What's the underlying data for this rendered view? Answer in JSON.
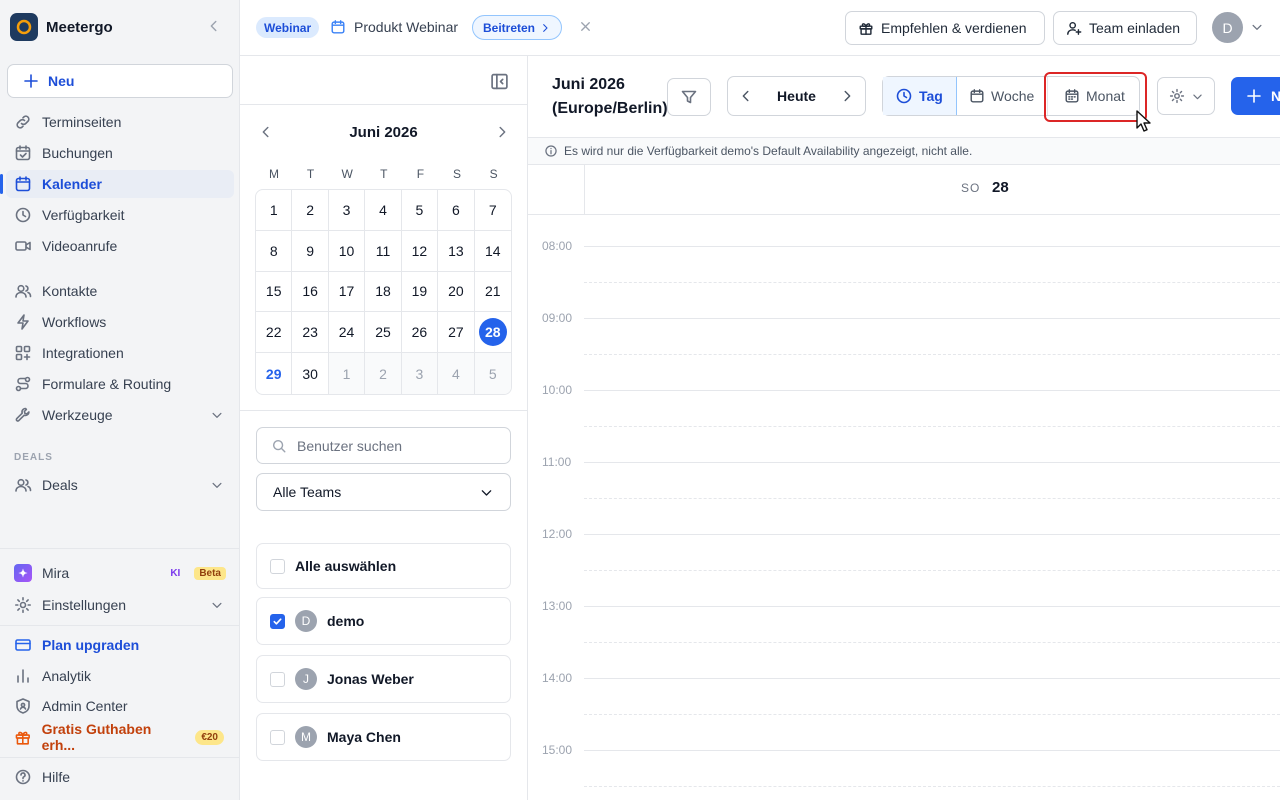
{
  "sidebar": {
    "brand": "Meetergo",
    "new_label": "Neu",
    "nav": [
      {
        "label": "Terminseiten",
        "icon": "link-icon"
      },
      {
        "label": "Buchungen",
        "icon": "calendar-check-icon"
      },
      {
        "label": "Kalender",
        "icon": "calendar-icon",
        "active": true
      },
      {
        "label": "Verfügbarkeit",
        "icon": "clock-icon"
      },
      {
        "label": "Videoanrufe",
        "icon": "video-icon"
      },
      {
        "label": "Kontakte",
        "icon": "users-icon"
      },
      {
        "label": "Workflows",
        "icon": "bolt-icon"
      },
      {
        "label": "Integrationen",
        "icon": "grid-icon"
      },
      {
        "label": "Formulare & Routing",
        "icon": "route-icon"
      },
      {
        "label": "Werkzeuge",
        "icon": "wrench-icon"
      }
    ],
    "deals_section": "DEALS",
    "deals_label": "Deals",
    "mira": {
      "label": "Mira",
      "ki": "KI",
      "beta": "Beta"
    },
    "settings_label": "Einstellungen",
    "upgrade_label": "Plan upgraden",
    "analytics_label": "Analytik",
    "admin_label": "Admin Center",
    "promo_label": "Gratis Guthaben erh...",
    "promo_badge": "€20",
    "help_label": "Hilfe"
  },
  "topbar": {
    "tag": "Webinar",
    "event_title": "Produkt Webinar",
    "join_label": "Beitreten",
    "refer_label": "Empfehlen & verdienen",
    "invite_label": "Team einladen",
    "avatar_initial": "D"
  },
  "mini_calendar": {
    "month_label": "Juni 2026",
    "weekdays": [
      "M",
      "T",
      "W",
      "T",
      "F",
      "S",
      "S"
    ],
    "days": [
      [
        "1",
        "2",
        "3",
        "4",
        "5",
        "6",
        "7"
      ],
      [
        "8",
        "9",
        "10",
        "11",
        "12",
        "13",
        "14"
      ],
      [
        "15",
        "16",
        "17",
        "18",
        "19",
        "20",
        "21"
      ],
      [
        "22",
        "23",
        "24",
        "25",
        "26",
        "27",
        "28"
      ],
      [
        "29",
        "30",
        "1",
        "2",
        "3",
        "4",
        "5"
      ]
    ],
    "today": "28",
    "highlight_next": "29"
  },
  "filters": {
    "search_placeholder": "Benutzer suchen",
    "team_select": "Alle Teams",
    "select_all": "Alle auswählen",
    "users": [
      {
        "initial": "D",
        "name": "demo",
        "checked": true
      },
      {
        "initial": "J",
        "name": "Jonas Weber",
        "checked": false
      },
      {
        "initial": "M",
        "name": "Maya Chen",
        "checked": false
      }
    ]
  },
  "calendar": {
    "title": "Juni 2026 (Europe/Berlin)",
    "today_label": "Heute",
    "views": {
      "day": "Tag",
      "week": "Woche",
      "month": "Monat"
    },
    "active_view": "Tag",
    "new_label": "N",
    "info": "Es wird nur die Verfügbarkeit demo's Default Availability angezeigt, nicht alle.",
    "day_label": "SO",
    "day_number": "28",
    "hours": [
      "08:00",
      "09:00",
      "10:00",
      "11:00",
      "12:00",
      "13:00",
      "14:00",
      "15:00"
    ]
  },
  "colors": {
    "accent": "#2563eb",
    "highlight": "#dc2626"
  }
}
